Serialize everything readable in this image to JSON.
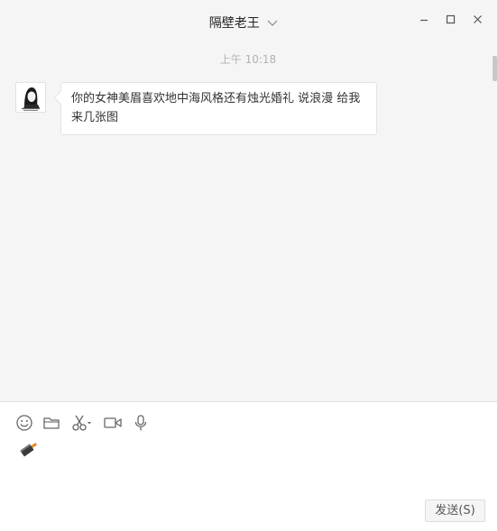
{
  "window": {
    "title": "隔壁老王"
  },
  "chat": {
    "timestamp": "上午 10:18",
    "messages": [
      {
        "sender": "contact",
        "avatar_icon": "profile-illustration-icon",
        "text": "你的女神美眉喜欢地中海风格还有烛光婚礼 说浪漫 给我来几张图"
      }
    ]
  },
  "toolbar": {
    "icons": [
      "emoji-icon",
      "folder-icon",
      "scissors-icon",
      "video-call-icon",
      "microphone-icon",
      "red-packet-icon"
    ]
  },
  "send_button": {
    "label": "发送(S)"
  },
  "colors": {
    "window_bg": "#f5f5f5",
    "input_bg": "#ffffff",
    "bubble_bg": "#ffffff",
    "timestamp": "#b2b2b2"
  }
}
